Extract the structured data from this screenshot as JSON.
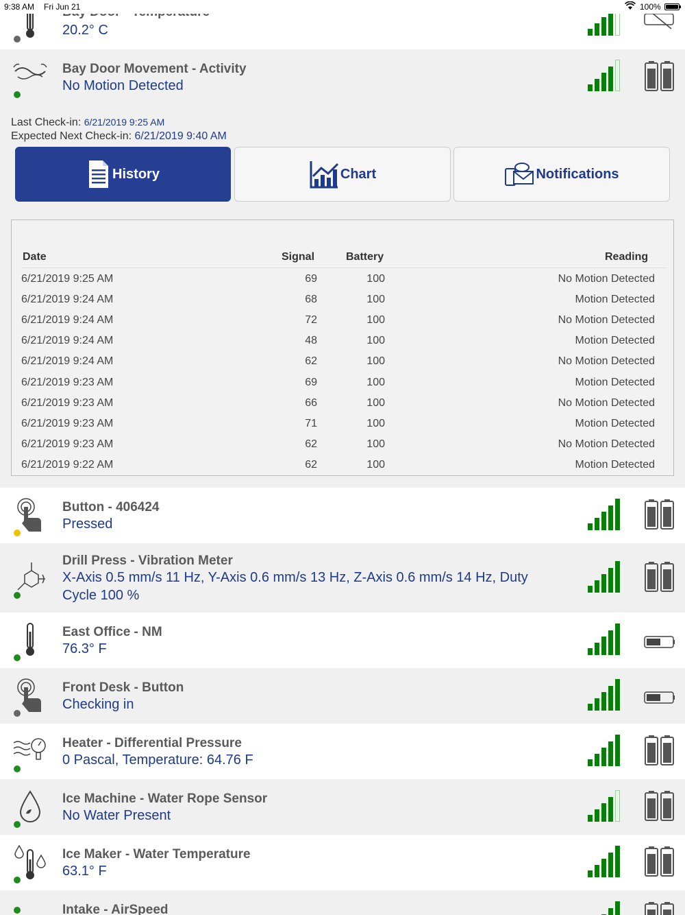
{
  "status_bar": {
    "time": "9:38 AM",
    "date": "Fri Jun 21",
    "battery": "100%"
  },
  "sensors_top": [
    {
      "name": "Bay Door - Temperature",
      "reading": "20.2° C"
    },
    {
      "name": "Bay Door Movement - Activity",
      "reading": "No Motion Detected"
    }
  ],
  "checkin": {
    "last_label": "Last Check-in:",
    "last_value": "6/21/2019 9:25 AM",
    "next_label": "Expected Next Check-in:",
    "next_value": "6/21/2019 9:40 AM"
  },
  "tabs": {
    "history": "History",
    "chart": "Chart",
    "notifications": "Notifications"
  },
  "history": {
    "columns": {
      "date": "Date",
      "signal": "Signal",
      "battery": "Battery",
      "reading": "Reading"
    },
    "rows": [
      {
        "date": "6/21/2019 9:25 AM",
        "signal": "69",
        "battery": "100",
        "reading": "No Motion Detected"
      },
      {
        "date": "6/21/2019 9:24 AM",
        "signal": "68",
        "battery": "100",
        "reading": "Motion Detected"
      },
      {
        "date": "6/21/2019 9:24 AM",
        "signal": "72",
        "battery": "100",
        "reading": "No Motion Detected"
      },
      {
        "date": "6/21/2019 9:24 AM",
        "signal": "48",
        "battery": "100",
        "reading": "Motion Detected"
      },
      {
        "date": "6/21/2019 9:24 AM",
        "signal": "62",
        "battery": "100",
        "reading": "No Motion Detected"
      },
      {
        "date": "6/21/2019 9:23 AM",
        "signal": "69",
        "battery": "100",
        "reading": "Motion Detected"
      },
      {
        "date": "6/21/2019 9:23 AM",
        "signal": "66",
        "battery": "100",
        "reading": "No Motion Detected"
      },
      {
        "date": "6/21/2019 9:23 AM",
        "signal": "71",
        "battery": "100",
        "reading": "Motion Detected"
      },
      {
        "date": "6/21/2019 9:23 AM",
        "signal": "62",
        "battery": "100",
        "reading": "No Motion Detected"
      },
      {
        "date": "6/21/2019 9:22 AM",
        "signal": "62",
        "battery": "100",
        "reading": "Motion Detected"
      }
    ]
  },
  "sensors": [
    {
      "name": "Button - 406424",
      "reading": "Pressed"
    },
    {
      "name": "Drill Press - Vibration Meter",
      "reading": "X-Axis 0.5 mm/s 11 Hz, Y-Axis 0.6 mm/s 13 Hz, Z-Axis 0.6 mm/s 14 Hz, Duty Cycle 100 %"
    },
    {
      "name": "East Office - NM",
      "reading": "76.3° F"
    },
    {
      "name": "Front Desk - Button",
      "reading": "Checking in"
    },
    {
      "name": "Heater - Differential Pressure",
      "reading": "0 Pascal, Temperature: 64.76 F"
    },
    {
      "name": "Ice Machine - Water Rope Sensor",
      "reading": "No Water Present"
    },
    {
      "name": "Ice Maker - Water Temperature",
      "reading": "63.1° F"
    },
    {
      "name": "Intake - AirSpeed",
      "reading": ""
    }
  ],
  "colors": {
    "accent": "#263f93",
    "reading_text": "#1e3a8a",
    "signal": "#0a7d0a",
    "status_green": "#1f8b1f",
    "status_yellow": "#f2c300"
  }
}
